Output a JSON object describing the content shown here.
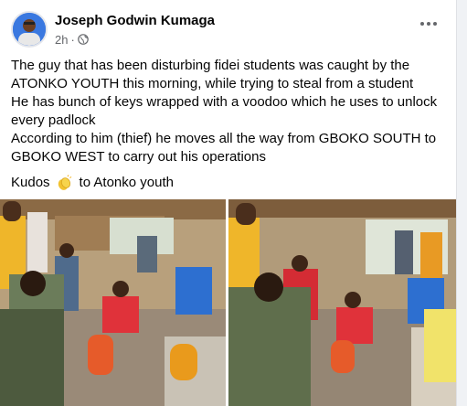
{
  "post": {
    "author": "Joseph Godwin Kumaga",
    "time": "2h",
    "separator": "·",
    "privacy_icon": "globe-icon",
    "more_icon": "more-options-icon",
    "lines": [
      "The guy that has been disturbing fidei students was caught by the",
      "ATONKO YOUTH this morning, while trying to steal from a student",
      "He has bunch of keys wrapped with a voodoo which he uses to unlock",
      "every padlock",
      "According to him (thief) he moves all the way from GBOKO SOUTH to",
      "GBOKO WEST to carry out his operations"
    ],
    "kudos_before": "Kudos",
    "kudos_emoji": "clapping-hands-icon",
    "kudos_after": "to Atonko youth"
  },
  "colors": {
    "text": "#050505",
    "secondary": "#65676b",
    "background": "#f0f2f5",
    "card": "#ffffff"
  }
}
